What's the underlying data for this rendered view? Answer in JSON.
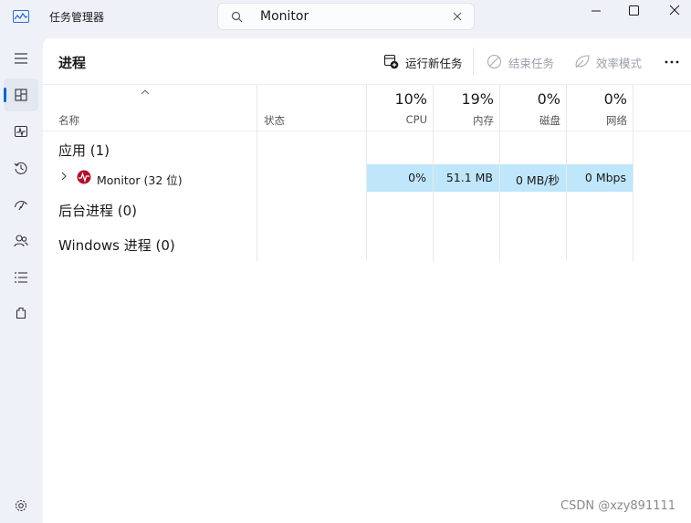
{
  "app": {
    "title": "任务管理器",
    "icon": "task-manager-icon"
  },
  "search": {
    "value": "Monitor"
  },
  "page": {
    "title": "进程"
  },
  "toolbar": {
    "run_new_task": "运行新任务",
    "end_task": "结束任务",
    "efficiency_mode": "效率模式"
  },
  "table": {
    "headers": {
      "name": "名称",
      "status": "状态"
    },
    "metrics": [
      {
        "percent": "10%",
        "label": "CPU"
      },
      {
        "percent": "19%",
        "label": "内存"
      },
      {
        "percent": "0%",
        "label": "磁盘"
      },
      {
        "percent": "0%",
        "label": "网络"
      }
    ],
    "groups": {
      "apps": "应用 (1)",
      "background": "后台进程 (0)",
      "windows": "Windows 进程 (0)"
    },
    "process": {
      "name": "Monitor (32 位)",
      "cpu": "0%",
      "memory": "51.1 MB",
      "disk": "0 MB/秒",
      "network": "0 Mbps"
    }
  },
  "nav": {
    "items": [
      "menu-icon",
      "processes-icon",
      "performance-icon",
      "app-history-icon",
      "startup-apps-icon",
      "users-icon",
      "details-icon",
      "services-icon",
      "settings-icon"
    ],
    "selected": "processes-icon"
  },
  "watermark": "CSDN @xzy891111",
  "colors": {
    "accent": "#0067c0",
    "highlight": "#bfe6fb",
    "background": "#eef2f8"
  }
}
